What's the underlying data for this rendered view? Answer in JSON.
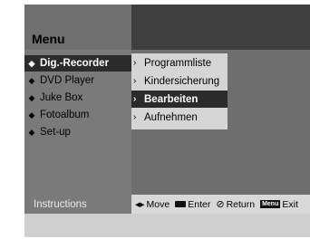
{
  "header": {
    "title": "Menu"
  },
  "main_menu": {
    "items": [
      {
        "label": "Dig.-Recorder",
        "active": true
      },
      {
        "label": "DVD Player",
        "active": false
      },
      {
        "label": "Juke Box",
        "active": false
      },
      {
        "label": "Fotoalbum",
        "active": false
      },
      {
        "label": "Set-up",
        "active": false
      }
    ]
  },
  "submenu": {
    "items": [
      {
        "label": "Programmliste",
        "active": false
      },
      {
        "label": "Kindersicherung",
        "active": false
      },
      {
        "label": "Bearbeiten",
        "active": true
      },
      {
        "label": "Aufnehmen",
        "active": false
      }
    ]
  },
  "instructions": {
    "label": "Instructions",
    "move": "Move",
    "enter": "Enter",
    "return": "Return",
    "menu_key": "Menu",
    "exit": "Exit"
  }
}
